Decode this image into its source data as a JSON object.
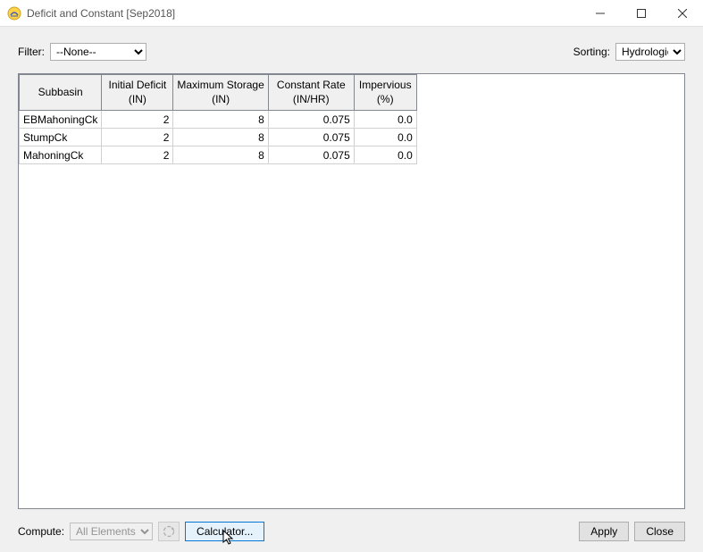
{
  "window": {
    "title": "Deficit and Constant [Sep2018]"
  },
  "toolbar": {
    "filter_label": "Filter:",
    "filter_value": "--None--",
    "sorting_label": "Sorting:",
    "sorting_value": "Hydrologic"
  },
  "table": {
    "headers": {
      "subbasin": "Subbasin",
      "initial_deficit": "Initial Deficit\n(IN)",
      "max_storage": "Maximum Storage\n(IN)",
      "constant_rate": "Constant Rate\n(IN/HR)",
      "impervious": "Impervious\n(%)"
    },
    "rows": [
      {
        "subbasin": "EBMahoningCk",
        "initial_deficit": "2",
        "max_storage": "8",
        "constant_rate": "0.075",
        "impervious": "0.0"
      },
      {
        "subbasin": "StumpCk",
        "initial_deficit": "2",
        "max_storage": "8",
        "constant_rate": "0.075",
        "impervious": "0.0"
      },
      {
        "subbasin": "MahoningCk",
        "initial_deficit": "2",
        "max_storage": "8",
        "constant_rate": "0.075",
        "impervious": "0.0"
      }
    ]
  },
  "bottom": {
    "compute_label": "Compute:",
    "compute_value": "All Elements",
    "calculator_label": "Calculator...",
    "apply_label": "Apply",
    "close_label": "Close"
  },
  "chart_data": {
    "type": "table",
    "title": "Deficit and Constant [Sep2018]",
    "columns": [
      "Subbasin",
      "Initial Deficit (IN)",
      "Maximum Storage (IN)",
      "Constant Rate (IN/HR)",
      "Impervious (%)"
    ],
    "rows": [
      [
        "EBMahoningCk",
        2,
        8,
        0.075,
        0.0
      ],
      [
        "StumpCk",
        2,
        8,
        0.075,
        0.0
      ],
      [
        "MahoningCk",
        2,
        8,
        0.075,
        0.0
      ]
    ]
  }
}
